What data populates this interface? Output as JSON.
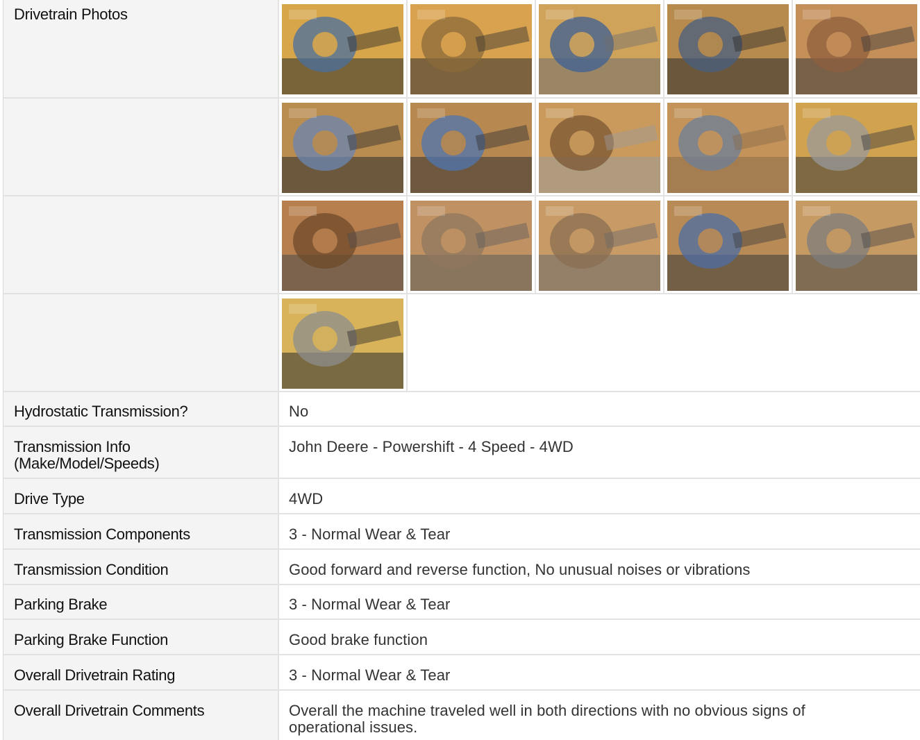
{
  "section": {
    "photos_label": "Drivetrain Photos",
    "photo_alt": "Drivetrain photo"
  },
  "photos": [
    {
      "name": "photo-1",
      "bg": "#d7a64b",
      "fg": "#4a6f9f",
      "accent": "#2b2b2b"
    },
    {
      "name": "photo-2",
      "bg": "#d9a24f",
      "fg": "#8a6a3a",
      "accent": "#303030"
    },
    {
      "name": "photo-3",
      "bg": "#cfa35a",
      "fg": "#3d5f96",
      "accent": "#6f6f6f"
    },
    {
      "name": "photo-4",
      "bg": "#b78b4d",
      "fg": "#475f80",
      "accent": "#2d2d2d"
    },
    {
      "name": "photo-5",
      "bg": "#c58f5a",
      "fg": "#8e5f3d",
      "accent": "#3a3a3a"
    },
    {
      "name": "photo-6",
      "bg": "#b98c4f",
      "fg": "#6b86b3",
      "accent": "#2e2e2e"
    },
    {
      "name": "photo-7",
      "bg": "#b78850",
      "fg": "#4f74b0",
      "accent": "#333333"
    },
    {
      "name": "photo-8",
      "bg": "#c99a5b",
      "fg": "#7a5533",
      "accent": "#9c9c9c"
    },
    {
      "name": "photo-9",
      "bg": "#c3935a",
      "fg": "#6b7f99",
      "accent": "#8a6b4a"
    },
    {
      "name": "photo-10",
      "bg": "#d1a34f",
      "fg": "#9a9a9a",
      "accent": "#3a3a3a"
    },
    {
      "name": "photo-11",
      "bg": "#b77f4e",
      "fg": "#6e4a2a",
      "accent": "#4d4d4d"
    },
    {
      "name": "photo-12",
      "bg": "#c09263",
      "fg": "#8f775e",
      "accent": "#5b5b5b"
    },
    {
      "name": "photo-13",
      "bg": "#c79a66",
      "fg": "#8a6d52",
      "accent": "#6a6a6a"
    },
    {
      "name": "photo-14",
      "bg": "#b88b56",
      "fg": "#4d6ea6",
      "accent": "#3b3b3b"
    },
    {
      "name": "photo-15",
      "bg": "#c69a63",
      "fg": "#7c7c7c",
      "accent": "#474747"
    },
    {
      "name": "photo-16",
      "bg": "#d8b35a",
      "fg": "#8d8d8d",
      "accent": "#2d2d2d"
    }
  ],
  "fields": [
    {
      "label": "Hydrostatic Transmission?",
      "value": "No"
    },
    {
      "label": "Transmission Info (Make/Model/Speeds)",
      "value": "John Deere - Powershift - 4 Speed - 4WD"
    },
    {
      "label": "Drive Type",
      "value": "4WD"
    },
    {
      "label": "Transmission Components",
      "value": "3 - Normal Wear & Tear"
    },
    {
      "label": "Transmission Condition",
      "value": "Good forward and reverse function, No unusual noises or vibrations"
    },
    {
      "label": "Parking Brake",
      "value": "3 - Normal Wear & Tear"
    },
    {
      "label": "Parking Brake Function",
      "value": "Good brake function"
    },
    {
      "label": "Overall Drivetrain Rating",
      "value": "3 - Normal Wear & Tear"
    },
    {
      "label": "Overall Drivetrain Comments",
      "value": "Overall the machine traveled well in both directions with no obvious signs of operational issues."
    }
  ]
}
